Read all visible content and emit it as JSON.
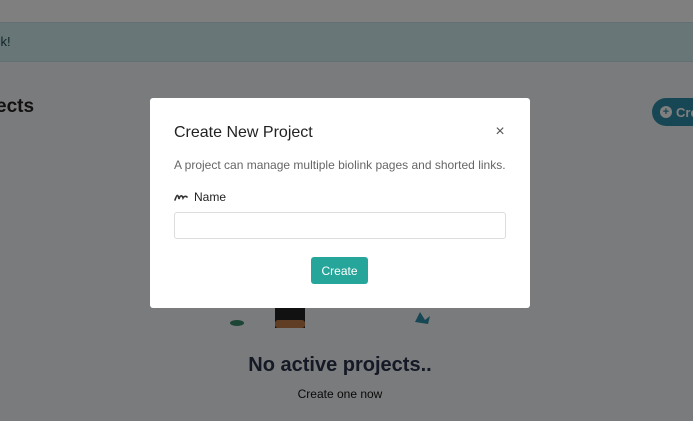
{
  "alert": {
    "text": "ck!"
  },
  "page": {
    "title": "ects",
    "create_button": "Cre"
  },
  "empty_state": {
    "title": "No active projects..",
    "subtitle": "Create one now"
  },
  "modal": {
    "title": "Create New Project",
    "close": "×",
    "description": "A project can manage multiple biolink pages and shorted links.",
    "name_label": "Name",
    "name_value": "",
    "name_placeholder": "",
    "submit_label": "Create",
    "icons": {
      "close": "close-icon",
      "name": "signature-icon"
    },
    "colors": {
      "submit": "#26a69a"
    }
  },
  "colors": {
    "alert_bg": "#d1ecee",
    "primary": "#2f8fa8"
  }
}
